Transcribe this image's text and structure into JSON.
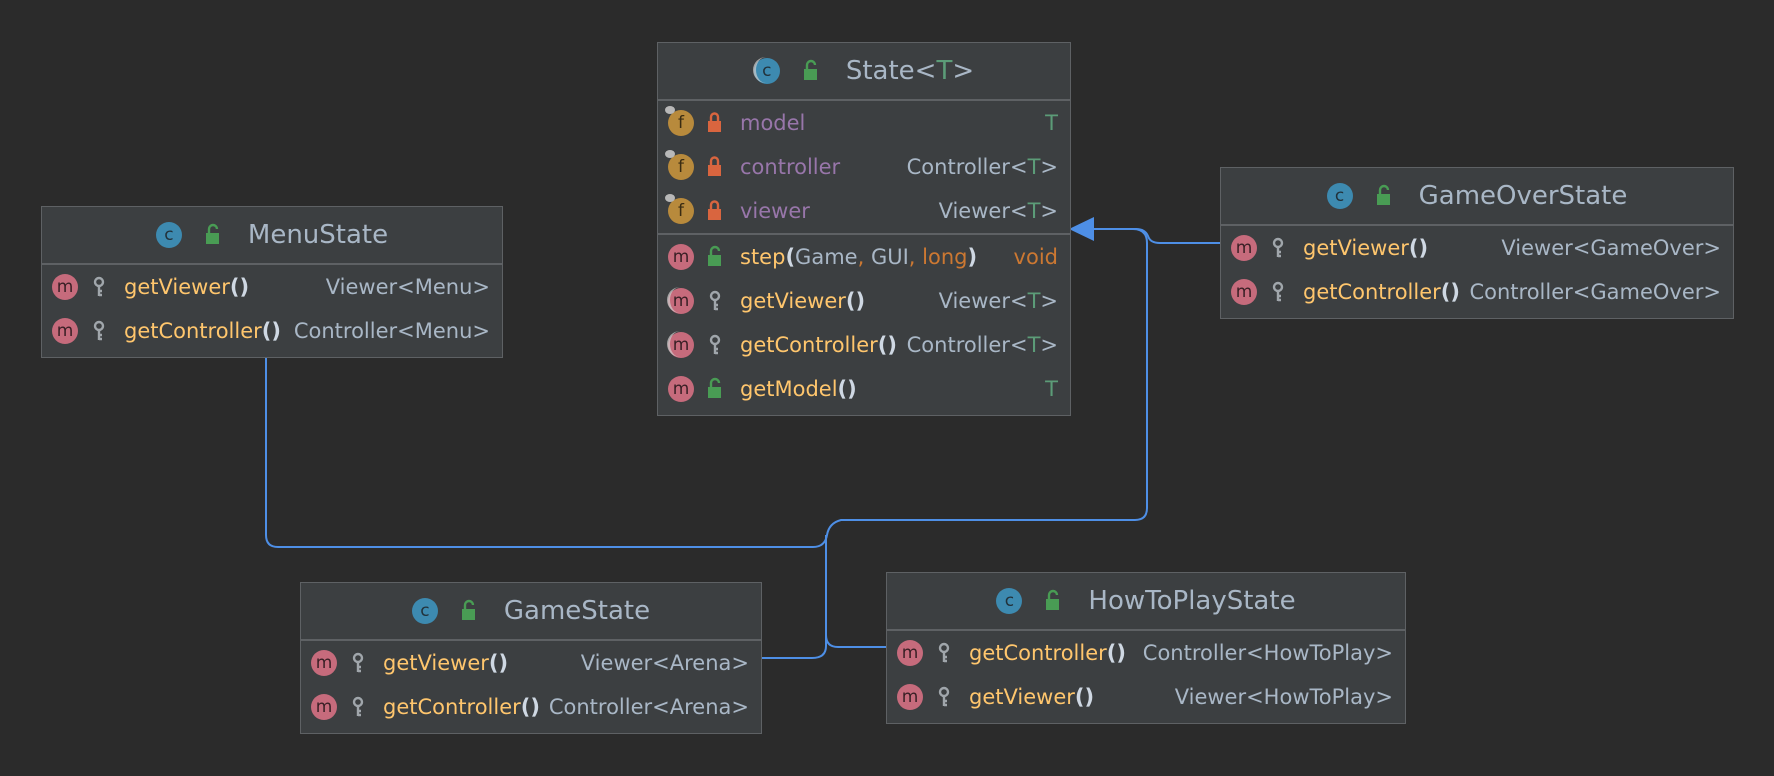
{
  "colors": {
    "background": "#2b2b2b",
    "box": "#3c3f41",
    "edge": "#4e8fe6",
    "method_name": "#ffc66d",
    "field_name": "#9876aa",
    "keyword": "#cc7832",
    "type_param": "#5c9c78"
  },
  "classes": {
    "state": {
      "badge": "c",
      "name": "State",
      "type_param": "T",
      "fields": [
        {
          "badge": "f",
          "name": "model",
          "type": "T"
        },
        {
          "badge": "f",
          "name": "controller",
          "type_base": "Controller",
          "type_param": "T"
        },
        {
          "badge": "f",
          "name": "viewer",
          "type_base": "Viewer",
          "type_param": "T"
        }
      ],
      "methods": [
        {
          "badge": "m",
          "name": "step",
          "args": [
            "Game",
            "GUI",
            "long"
          ],
          "return": "void"
        },
        {
          "badge": "m",
          "name": "getViewer",
          "paren": "()",
          "type_base": "Viewer",
          "type_param": "T"
        },
        {
          "badge": "m",
          "name": "getController",
          "paren": "()",
          "type_base": "Controller",
          "type_param": "T"
        },
        {
          "badge": "m",
          "name": "getModel",
          "paren": "()",
          "type": "T"
        }
      ]
    },
    "menu_state": {
      "badge": "c",
      "name": "MenuState",
      "methods": [
        {
          "badge": "m",
          "name": "getViewer",
          "paren": "()",
          "type": "Viewer<Menu>"
        },
        {
          "badge": "m",
          "name": "getController",
          "paren": "()",
          "type": "Controller<Menu>"
        }
      ]
    },
    "game_over_state": {
      "badge": "c",
      "name": "GameOverState",
      "methods": [
        {
          "badge": "m",
          "name": "getViewer",
          "paren": "()",
          "type": "Viewer<GameOver>"
        },
        {
          "badge": "m",
          "name": "getController",
          "paren": "()",
          "type": "Controller<GameOver>"
        }
      ]
    },
    "game_state": {
      "badge": "c",
      "name": "GameState",
      "methods": [
        {
          "badge": "m",
          "name": "getViewer",
          "paren": "()",
          "type": "Viewer<Arena>"
        },
        {
          "badge": "m",
          "name": "getController",
          "paren": "()",
          "type": "Controller<Arena>"
        }
      ]
    },
    "how_to_play_state": {
      "badge": "c",
      "name": "HowToPlayState",
      "methods": [
        {
          "badge": "m",
          "name": "getController",
          "paren": "()",
          "type": "Controller<HowToPlay>"
        },
        {
          "badge": "m",
          "name": "getViewer",
          "paren": "()",
          "type": "Viewer<HowToPlay>"
        }
      ]
    }
  },
  "punct": {
    "lt": "<",
    "gt": ">",
    "open": "(",
    "close": ")",
    "comma": ","
  }
}
